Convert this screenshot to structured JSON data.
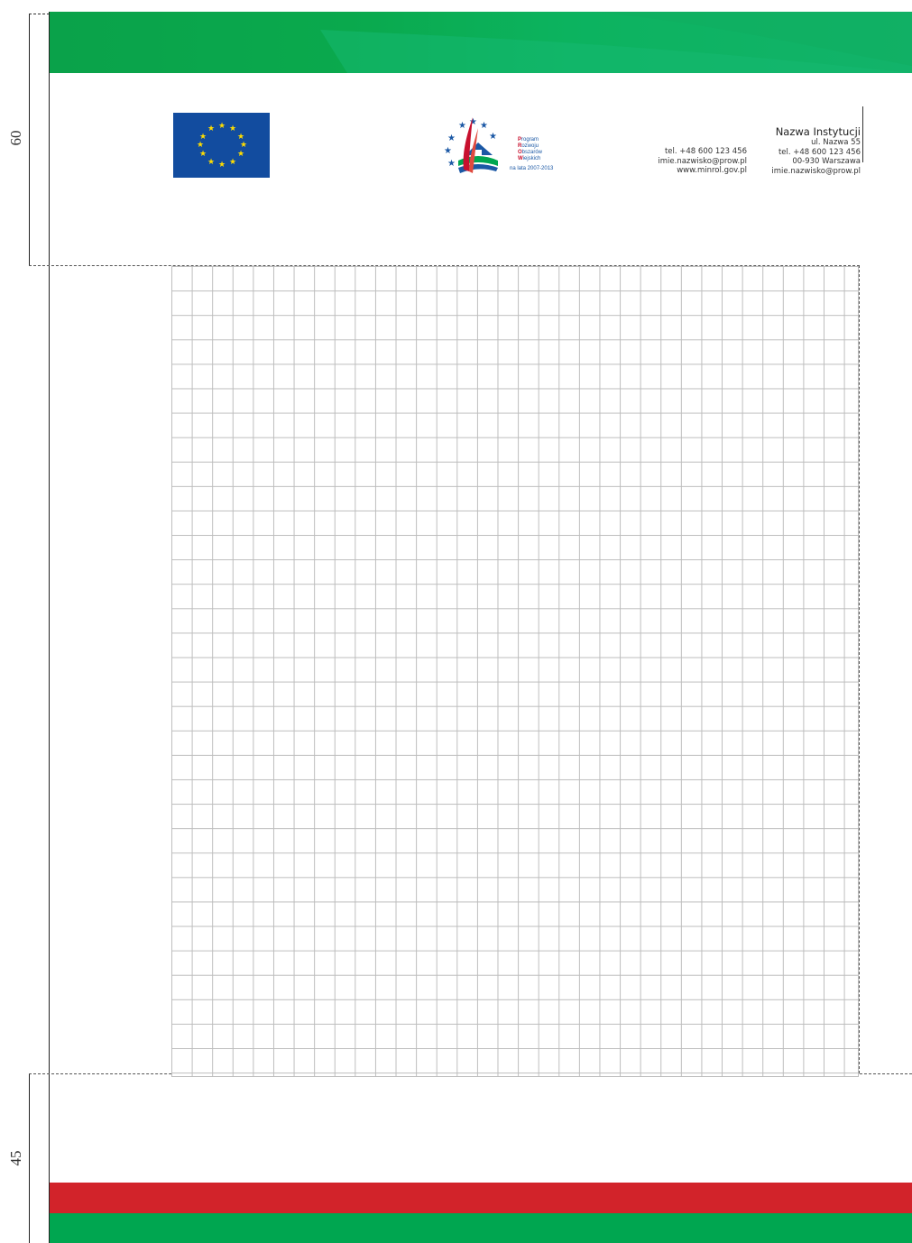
{
  "dimensions": {
    "top_margin_label": "60",
    "bottom_margin_label": "45"
  },
  "colors": {
    "top_band": "#0aa94d",
    "red_band": "#d2232a",
    "green_band": "#00a650",
    "eu_blue": "#124c9f",
    "eu_star": "#ffdd00",
    "prow_blue": "#1b58a5"
  },
  "eu_flag": {
    "icon": "eu-flag-icon"
  },
  "prow_logo": {
    "icon": "prow-logo-icon",
    "lines": [
      {
        "initial": "P",
        "rest": "rogram"
      },
      {
        "initial": "R",
        "rest": "ozwoju"
      },
      {
        "initial": "O",
        "rest": "bszarów"
      },
      {
        "initial": "W",
        "rest": "iejskich"
      }
    ],
    "years": "na lata 2007-2013"
  },
  "contact_left": {
    "phone": "tel. +48 600 123 456",
    "email": "imie.nazwisko@prow.pl",
    "website": "www.minrol.gov.pl"
  },
  "contact_right": {
    "institution": "Nazwa Instytucji",
    "street": "ul. Nazwa 55",
    "phone": "tel. +48 600 123 456",
    "city": "00-930 Warszawa",
    "email": "imie.nazwisko@prow.pl"
  }
}
